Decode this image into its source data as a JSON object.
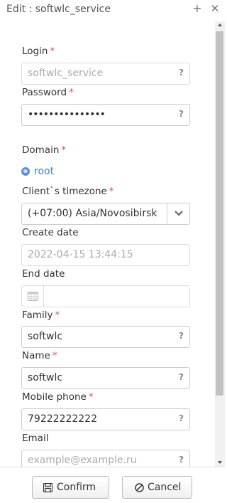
{
  "dialog": {
    "title": "Edit : softwlc_service",
    "add_icon": "plus-icon",
    "close_icon": "close-icon"
  },
  "form": {
    "login": {
      "label": "Login",
      "value": "softwlc_service",
      "help": "?"
    },
    "password": {
      "label": "Password",
      "value": "•••••••••••••••",
      "help": "?"
    },
    "domain": {
      "label": "Domain",
      "value": "root",
      "icon": "globe-icon"
    },
    "timezone": {
      "label": "Client`s timezone",
      "value": "(+07:00) Asia/Novosibirsk"
    },
    "create_date": {
      "label": "Create date",
      "value": "2022-04-15 13:44:15"
    },
    "end_date": {
      "label": "End date",
      "value": "",
      "icon": "calendar-icon"
    },
    "family": {
      "label": "Family",
      "value": "softwlc",
      "help": "?"
    },
    "name": {
      "label": "Name",
      "value": "softwlc",
      "help": "?"
    },
    "mobile_phone": {
      "label": "Mobile phone",
      "value": "79222222222",
      "help": "?"
    },
    "email": {
      "label": "Email",
      "placeholder": "example@example.ru",
      "help": "?"
    },
    "required_mark": "*"
  },
  "buttons": {
    "confirm": {
      "label": "Confirm",
      "icon": "save-icon"
    },
    "cancel": {
      "label": "Cancel",
      "icon": "cancel-icon"
    }
  },
  "colors": {
    "required": "#d9534f",
    "link": "#3a7fd5",
    "border": "#cccccc"
  }
}
